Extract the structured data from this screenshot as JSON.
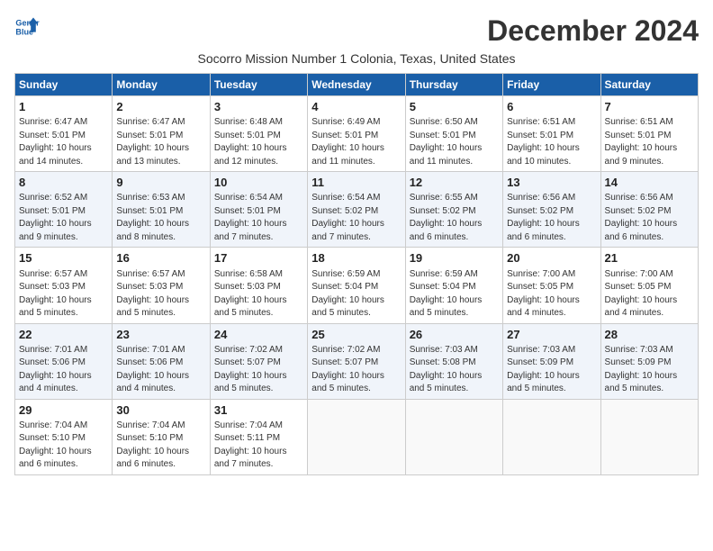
{
  "logo": {
    "general": "General",
    "blue": "Blue"
  },
  "title": "December 2024",
  "subtitle": "Socorro Mission Number 1 Colonia, Texas, United States",
  "days_of_week": [
    "Sunday",
    "Monday",
    "Tuesday",
    "Wednesday",
    "Thursday",
    "Friday",
    "Saturday"
  ],
  "weeks": [
    [
      {
        "day": "1",
        "info": "Sunrise: 6:47 AM\nSunset: 5:01 PM\nDaylight: 10 hours and 14 minutes."
      },
      {
        "day": "2",
        "info": "Sunrise: 6:47 AM\nSunset: 5:01 PM\nDaylight: 10 hours and 13 minutes."
      },
      {
        "day": "3",
        "info": "Sunrise: 6:48 AM\nSunset: 5:01 PM\nDaylight: 10 hours and 12 minutes."
      },
      {
        "day": "4",
        "info": "Sunrise: 6:49 AM\nSunset: 5:01 PM\nDaylight: 10 hours and 11 minutes."
      },
      {
        "day": "5",
        "info": "Sunrise: 6:50 AM\nSunset: 5:01 PM\nDaylight: 10 hours and 11 minutes."
      },
      {
        "day": "6",
        "info": "Sunrise: 6:51 AM\nSunset: 5:01 PM\nDaylight: 10 hours and 10 minutes."
      },
      {
        "day": "7",
        "info": "Sunrise: 6:51 AM\nSunset: 5:01 PM\nDaylight: 10 hours and 9 minutes."
      }
    ],
    [
      {
        "day": "8",
        "info": "Sunrise: 6:52 AM\nSunset: 5:01 PM\nDaylight: 10 hours and 9 minutes."
      },
      {
        "day": "9",
        "info": "Sunrise: 6:53 AM\nSunset: 5:01 PM\nDaylight: 10 hours and 8 minutes."
      },
      {
        "day": "10",
        "info": "Sunrise: 6:54 AM\nSunset: 5:01 PM\nDaylight: 10 hours and 7 minutes."
      },
      {
        "day": "11",
        "info": "Sunrise: 6:54 AM\nSunset: 5:02 PM\nDaylight: 10 hours and 7 minutes."
      },
      {
        "day": "12",
        "info": "Sunrise: 6:55 AM\nSunset: 5:02 PM\nDaylight: 10 hours and 6 minutes."
      },
      {
        "day": "13",
        "info": "Sunrise: 6:56 AM\nSunset: 5:02 PM\nDaylight: 10 hours and 6 minutes."
      },
      {
        "day": "14",
        "info": "Sunrise: 6:56 AM\nSunset: 5:02 PM\nDaylight: 10 hours and 6 minutes."
      }
    ],
    [
      {
        "day": "15",
        "info": "Sunrise: 6:57 AM\nSunset: 5:03 PM\nDaylight: 10 hours and 5 minutes."
      },
      {
        "day": "16",
        "info": "Sunrise: 6:57 AM\nSunset: 5:03 PM\nDaylight: 10 hours and 5 minutes."
      },
      {
        "day": "17",
        "info": "Sunrise: 6:58 AM\nSunset: 5:03 PM\nDaylight: 10 hours and 5 minutes."
      },
      {
        "day": "18",
        "info": "Sunrise: 6:59 AM\nSunset: 5:04 PM\nDaylight: 10 hours and 5 minutes."
      },
      {
        "day": "19",
        "info": "Sunrise: 6:59 AM\nSunset: 5:04 PM\nDaylight: 10 hours and 5 minutes."
      },
      {
        "day": "20",
        "info": "Sunrise: 7:00 AM\nSunset: 5:05 PM\nDaylight: 10 hours and 4 minutes."
      },
      {
        "day": "21",
        "info": "Sunrise: 7:00 AM\nSunset: 5:05 PM\nDaylight: 10 hours and 4 minutes."
      }
    ],
    [
      {
        "day": "22",
        "info": "Sunrise: 7:01 AM\nSunset: 5:06 PM\nDaylight: 10 hours and 4 minutes."
      },
      {
        "day": "23",
        "info": "Sunrise: 7:01 AM\nSunset: 5:06 PM\nDaylight: 10 hours and 4 minutes."
      },
      {
        "day": "24",
        "info": "Sunrise: 7:02 AM\nSunset: 5:07 PM\nDaylight: 10 hours and 5 minutes."
      },
      {
        "day": "25",
        "info": "Sunrise: 7:02 AM\nSunset: 5:07 PM\nDaylight: 10 hours and 5 minutes."
      },
      {
        "day": "26",
        "info": "Sunrise: 7:03 AM\nSunset: 5:08 PM\nDaylight: 10 hours and 5 minutes."
      },
      {
        "day": "27",
        "info": "Sunrise: 7:03 AM\nSunset: 5:09 PM\nDaylight: 10 hours and 5 minutes."
      },
      {
        "day": "28",
        "info": "Sunrise: 7:03 AM\nSunset: 5:09 PM\nDaylight: 10 hours and 5 minutes."
      }
    ],
    [
      {
        "day": "29",
        "info": "Sunrise: 7:04 AM\nSunset: 5:10 PM\nDaylight: 10 hours and 6 minutes."
      },
      {
        "day": "30",
        "info": "Sunrise: 7:04 AM\nSunset: 5:10 PM\nDaylight: 10 hours and 6 minutes."
      },
      {
        "day": "31",
        "info": "Sunrise: 7:04 AM\nSunset: 5:11 PM\nDaylight: 10 hours and 7 minutes."
      },
      {
        "day": "",
        "info": ""
      },
      {
        "day": "",
        "info": ""
      },
      {
        "day": "",
        "info": ""
      },
      {
        "day": "",
        "info": ""
      }
    ]
  ]
}
